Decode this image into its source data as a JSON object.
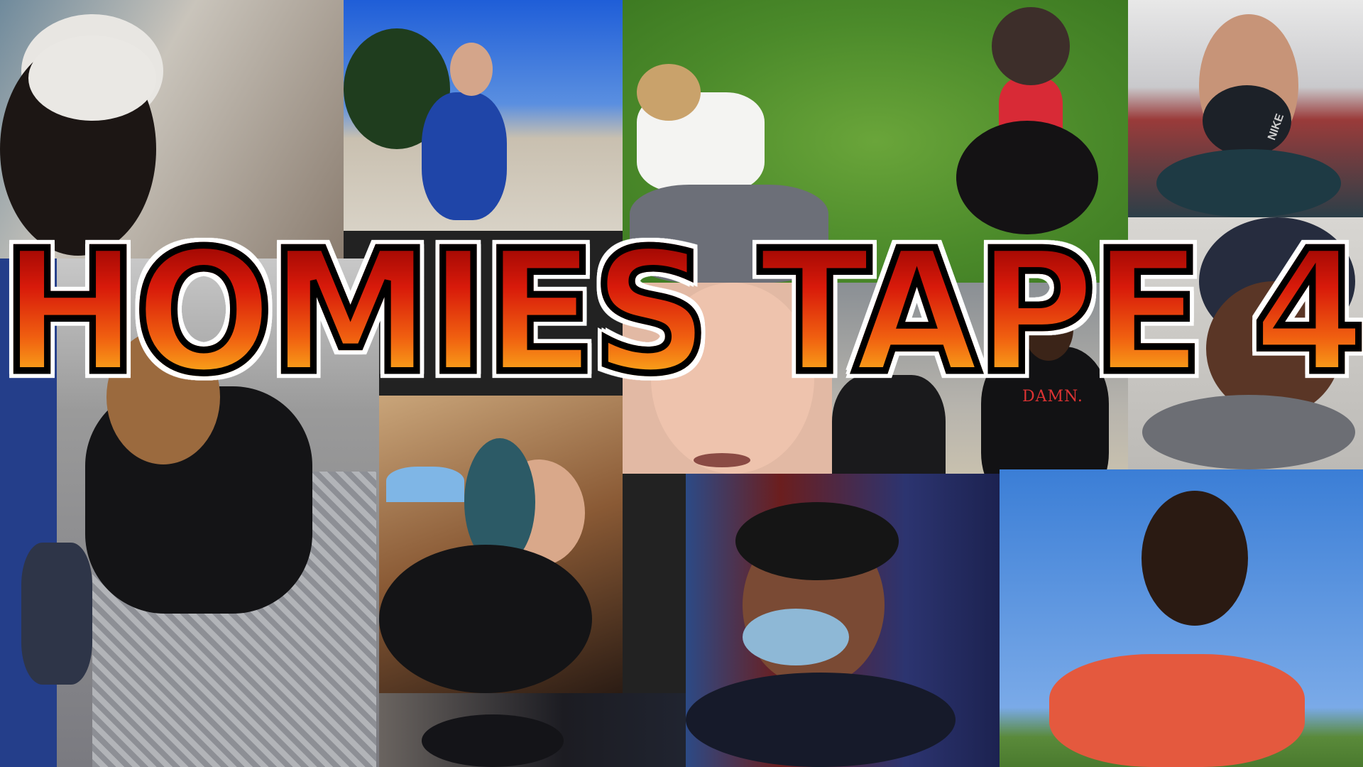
{
  "title": "HOMIES TAPE 4",
  "shirt_text": "DAMN.",
  "mask_text": "NIKE",
  "colors": {
    "title_top": "#8a0000",
    "title_mid": "#f06010",
    "title_bottom": "#ffd020",
    "outline": "#000000",
    "halo": "#ffffff"
  }
}
